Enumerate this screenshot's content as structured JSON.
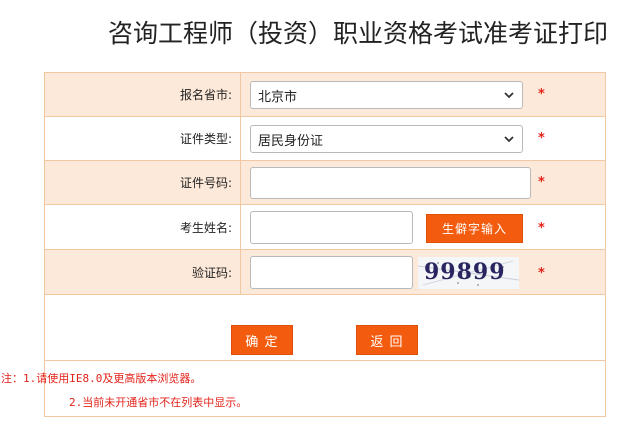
{
  "page": {
    "title": "咨询工程师（投资）职业资格考试准考证打印"
  },
  "form": {
    "province": {
      "label": "报名省市:",
      "value": "北京市"
    },
    "id_type": {
      "label": "证件类型:",
      "value": "居民身份证"
    },
    "id_number": {
      "label": "证件号码:",
      "value": ""
    },
    "name": {
      "label": "考生姓名:",
      "value": "",
      "rare_char_button": "生僻字输入"
    },
    "captcha": {
      "label": "验证码:",
      "value": "",
      "image_text": "99899"
    },
    "required_mark": "*"
  },
  "actions": {
    "confirm": "确 定",
    "back": "返 回"
  },
  "notes": {
    "line1": "注：1.请使用IE8.0及更高版本浏览器。",
    "line2": "2.当前未开通省市不在列表中显示。"
  },
  "colors": {
    "accent": "#f35c0e",
    "row_tint": "#fde9d9",
    "border": "#f0c9a4",
    "required": "#e2231a"
  }
}
